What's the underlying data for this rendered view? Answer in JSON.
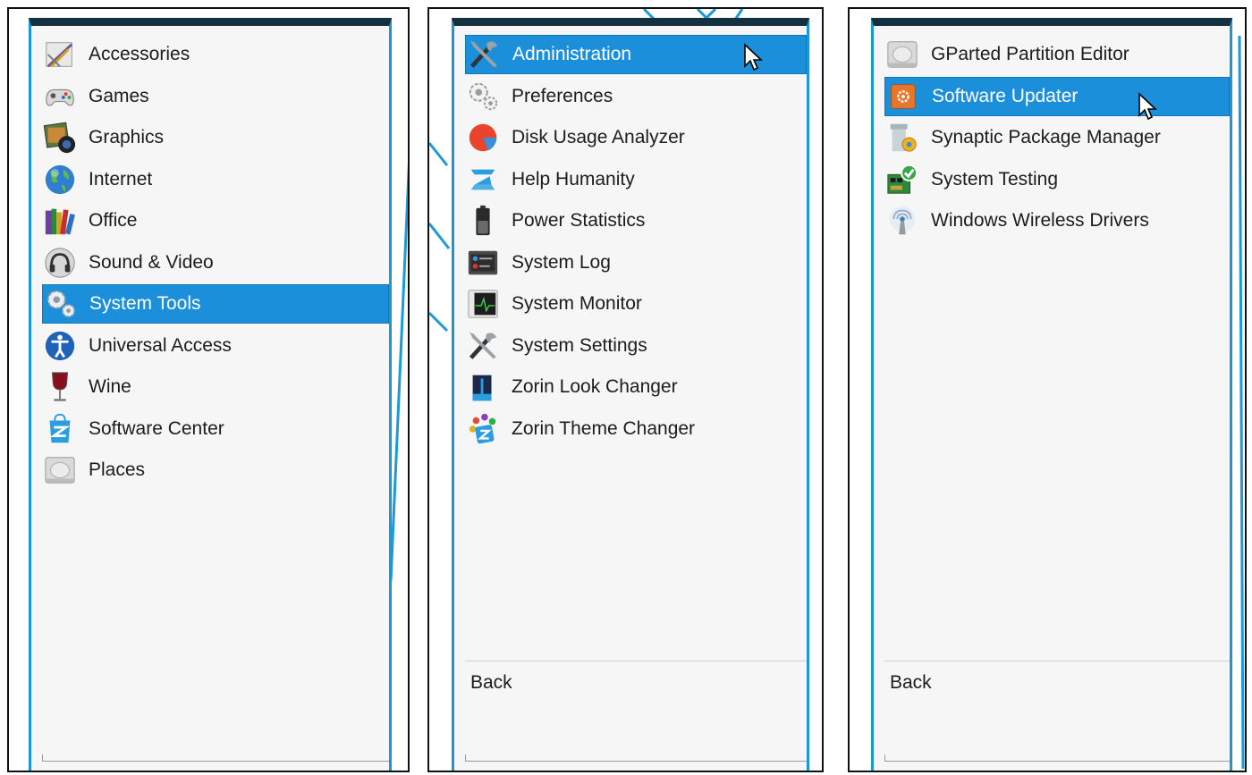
{
  "panel_1": {
    "items": [
      {
        "label": "Accessories",
        "icon": "accessories-icon"
      },
      {
        "label": "Games",
        "icon": "gamepad-icon"
      },
      {
        "label": "Graphics",
        "icon": "graphics-icon"
      },
      {
        "label": "Internet",
        "icon": "globe-icon"
      },
      {
        "label": "Office",
        "icon": "books-icon"
      },
      {
        "label": "Sound & Video",
        "icon": "headphones-icon"
      },
      {
        "label": "System Tools",
        "icon": "gears-icon",
        "selected": true
      },
      {
        "label": "Universal Access",
        "icon": "accessibility-icon"
      },
      {
        "label": "Wine",
        "icon": "wine-glass-icon"
      },
      {
        "label": "Software Center",
        "icon": "software-center-icon"
      },
      {
        "label": "Places",
        "icon": "drive-icon"
      }
    ]
  },
  "panel_2": {
    "items": [
      {
        "label": "Administration",
        "icon": "tools-icon",
        "selected": true
      },
      {
        "label": "Preferences",
        "icon": "gears-icon"
      },
      {
        "label": "Disk Usage Analyzer",
        "icon": "pie-chart-icon"
      },
      {
        "label": "Help Humanity",
        "icon": "zorin-logo-icon"
      },
      {
        "label": "Power Statistics",
        "icon": "battery-icon"
      },
      {
        "label": "System Log",
        "icon": "system-log-icon"
      },
      {
        "label": "System Monitor",
        "icon": "system-monitor-icon"
      },
      {
        "label": "System Settings",
        "icon": "tools-icon"
      },
      {
        "label": "Zorin Look Changer",
        "icon": "look-changer-icon"
      },
      {
        "label": "Zorin Theme Changer",
        "icon": "theme-changer-icon"
      }
    ],
    "back_label": "Back"
  },
  "panel_3": {
    "items": [
      {
        "label": "GParted Partition Editor",
        "icon": "drive-icon"
      },
      {
        "label": "Software Updater",
        "icon": "software-updater-icon",
        "selected": true
      },
      {
        "label": "Synaptic Package Manager",
        "icon": "package-icon"
      },
      {
        "label": "System Testing",
        "icon": "system-testing-icon"
      },
      {
        "label": "Windows Wireless Drivers",
        "icon": "wireless-icon"
      }
    ],
    "back_label": "Back"
  },
  "colors": {
    "selection": "#1c8fda",
    "accent": "#1b97d3",
    "menu_background": "#f6f6f6",
    "text": "#1c1c1c"
  }
}
